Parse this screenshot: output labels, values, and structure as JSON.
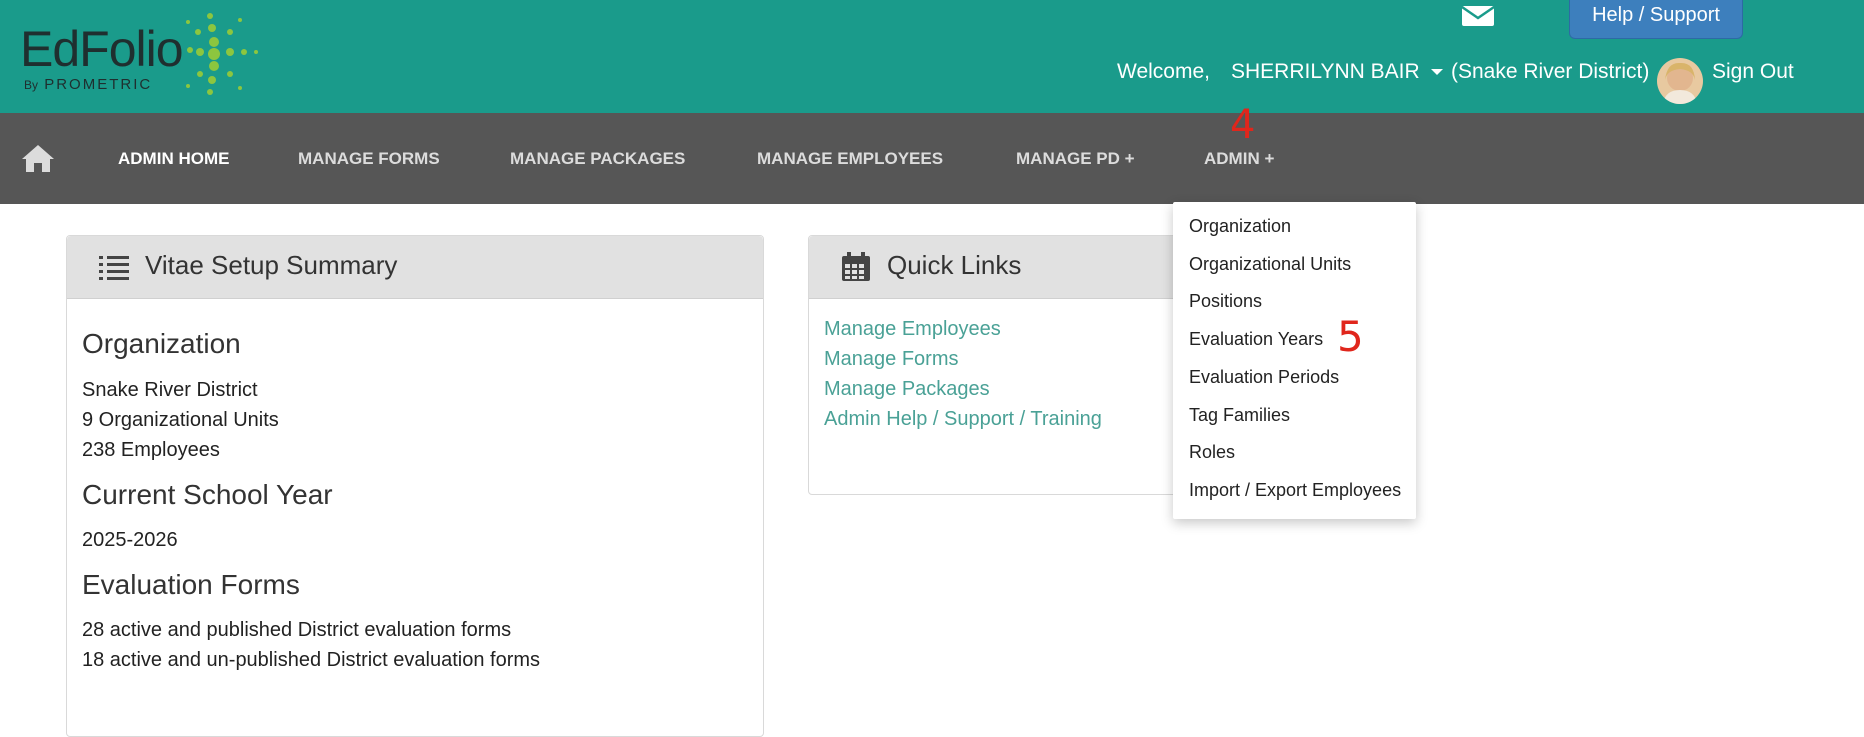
{
  "header": {
    "logo_main": "EdFolio",
    "logo_by": "By",
    "logo_company": "PROMETRIC",
    "help_label": "Help / Support",
    "welcome_label": "Welcome,",
    "user_name": "SHERRILYNN BAIR",
    "district": "(Snake River District)",
    "sign_out": "Sign Out",
    "mail_icon": "envelope-icon",
    "brand_color": "#1a9b8b"
  },
  "nav": {
    "home_icon": "home-icon",
    "items": [
      {
        "label": "ADMIN HOME",
        "active": true
      },
      {
        "label": "MANAGE FORMS"
      },
      {
        "label": "MANAGE PACKAGES"
      },
      {
        "label": "MANAGE EMPLOYEES"
      },
      {
        "label": "MANAGE PD +"
      },
      {
        "label": "ADMIN +"
      }
    ]
  },
  "markers": {
    "step4": "4",
    "step5": "5"
  },
  "summary": {
    "title": "Vitae Setup Summary",
    "org_heading": "Organization",
    "org_name": "Snake River District",
    "org_units": "9 Organizational Units",
    "employees": "238 Employees",
    "year_heading": "Current School Year",
    "year": "2025-2026",
    "forms_heading": "Evaluation Forms",
    "forms_published": "28 active and published District evaluation forms",
    "forms_unpublished": "18 active and un-published District evaluation forms"
  },
  "quick_links": {
    "title": "Quick Links",
    "links": [
      "Manage Employees",
      "Manage Forms",
      "Manage Packages",
      "Admin Help / Support / Training"
    ]
  },
  "admin_menu": {
    "items": [
      "Organization",
      "Organizational Units",
      "Positions",
      "Evaluation Years",
      "Evaluation Periods",
      "Tag Families",
      "Roles",
      "Import / Export Employees"
    ]
  }
}
